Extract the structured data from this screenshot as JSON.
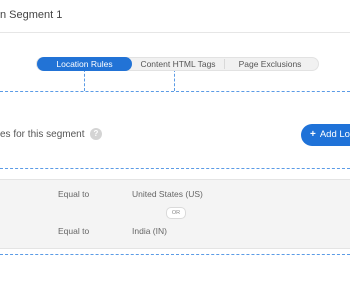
{
  "header": {
    "title": "n Segment 1"
  },
  "tabs": [
    {
      "label": "Location Rules",
      "active": true
    },
    {
      "label": "Content HTML Tags",
      "active": false
    },
    {
      "label": "Page Exclusions",
      "active": false
    }
  ],
  "rules_section": {
    "heading": "es for this segment",
    "help_icon": "question-icon",
    "add_button_label": "Add Lo",
    "add_button_icon": "plus-icon"
  },
  "rules": [
    {
      "operator": "Equal to",
      "value": "United States (US)"
    },
    {
      "operator": "Equal to",
      "value": "India (IN)"
    }
  ],
  "connector_label": "OR",
  "colors": {
    "accent": "#2273d6",
    "dashed_guide": "#5b9be6"
  }
}
